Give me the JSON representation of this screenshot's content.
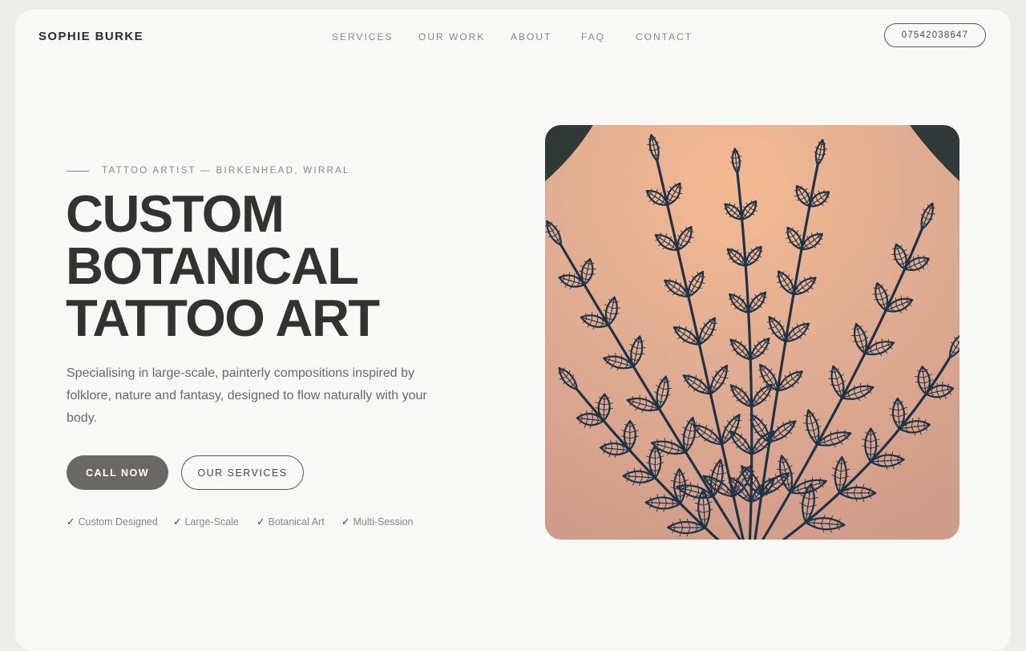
{
  "brand": "SOPHIE BURKE",
  "nav": {
    "services": "SERVICES",
    "work": "OUR WORK",
    "about": "ABOUT",
    "faq": "FAQ",
    "contact": "CONTACT"
  },
  "phone": "07542038647",
  "hero": {
    "eyebrow": "TATTOO ARTIST — BIRKENHEAD, WIRRAL",
    "headline": [
      "CUSTOM",
      "BOTANICAL",
      "TATTOO ART"
    ],
    "description": "Specialising in large-scale, painterly compositions inspired by folklore, nature and fantasy, designed to flow naturally with your body.",
    "primary_button": "CALL NOW",
    "secondary_button": "OUR SERVICES",
    "features": [
      "Custom Designed",
      "Large-Scale",
      "Botanical Art",
      "Multi-Session"
    ],
    "check_glyph": "✓"
  },
  "colors": {
    "ink": "#1e3346",
    "skin": "#d7a98c",
    "primary_button": "#6b6862"
  }
}
